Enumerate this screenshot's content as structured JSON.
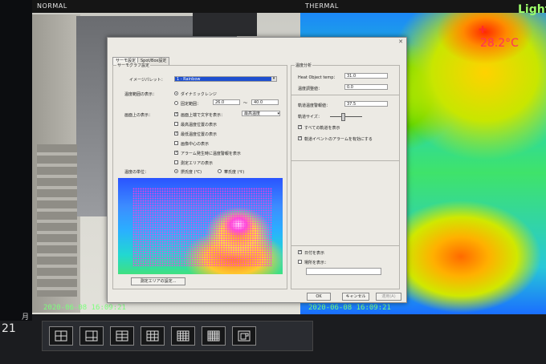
{
  "monitor": {
    "normal_label": "NORMAL",
    "thermal_label": "THERMAL",
    "light_label": "Light",
    "temp_readout": "28.2°C",
    "timestamp_left": "2020-06-08 16:09:21",
    "timestamp_right": "2020-06-08 16:09:21",
    "side_month": "月",
    "side_day": "21"
  },
  "taskbar": {
    "layouts": [
      "layout-1x1",
      "layout-1-plus-3",
      "layout-2x2",
      "layout-3x3",
      "layout-4x4",
      "layout-5x5",
      "layout-2-cam"
    ]
  },
  "dialog": {
    "tabs": [
      "サーモ設定",
      "Spot/Box設定"
    ],
    "thermo_group_title": "サーモグラフ設定",
    "image_palette_label": "イメージパレット：",
    "image_palette_value": "1 - Rainbow",
    "temp_range_label": "温度範囲の表示：",
    "dynamic_range_label": "ダイナミックレンジ",
    "fixed_range_label": "固定範囲：",
    "range_min": "26.0",
    "range_sep": "～",
    "range_max": "40.0",
    "screen_display_label": "画面上の表示：",
    "show_text_upper_label": "画面上端で文字を表示：",
    "text_select_value": "最高温度",
    "show_max_pos_label": "最高温度位置の表示",
    "show_min_pos_label": "最低温度位置の表示",
    "show_center_label": "画像中心の表示",
    "show_alarm_temp_label": "アラーム発生時に温度警報を表示",
    "show_spec_area_label": "測定エリアの表示",
    "temp_unit_label": "温度の単位：",
    "celsius_label": "摂氏度 (℃)",
    "fahrenheit_label": "華氏度 (℉)",
    "set_area_button": "測定エリアの設定...",
    "analysis_title": "温度分析",
    "heat_object_label": "Heat Object temp：",
    "heat_object_value": "31.0",
    "temp_adjust_label": "温度調整値：",
    "temp_adjust_value": "0.0",
    "body_threshold_label": "軌道温度警報値：",
    "body_threshold_value": "37.5",
    "trace_size_label": "軌道サイズ：",
    "show_all_traces_label": "すべての軌道を表示",
    "enable_alarm_label": "軌道イベントのアラームを有効にする",
    "show_date_label": "日付を表示",
    "show_location_label": "場所を表示：",
    "ok_button": "OK",
    "cancel_button": "キャンセル",
    "apply_button": "適用(A)"
  }
}
